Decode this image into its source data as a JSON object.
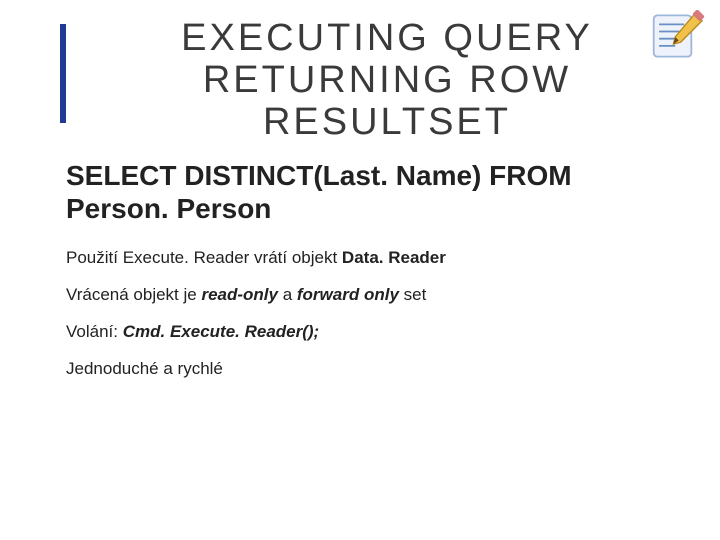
{
  "title": "EXECUTING QUERY RETURNING ROW RESULTSET",
  "subtitle": "SELECT DISTINCT(Last. Name) FROM Person. Person",
  "line1_pre": "Použití Execute. Reader vrátí objekt ",
  "line1_bold": "Data. Reader",
  "line2_pre": "Vrácená objekt je ",
  "line2_bi1": "read-only",
  "line2_mid": " a ",
  "line2_bi2": "forward only",
  "line2_post": " set",
  "line3_pre": "Volání: ",
  "line3_bi": "Cmd. Execute. Reader();",
  "line4": "Jednoduché a rychlé"
}
